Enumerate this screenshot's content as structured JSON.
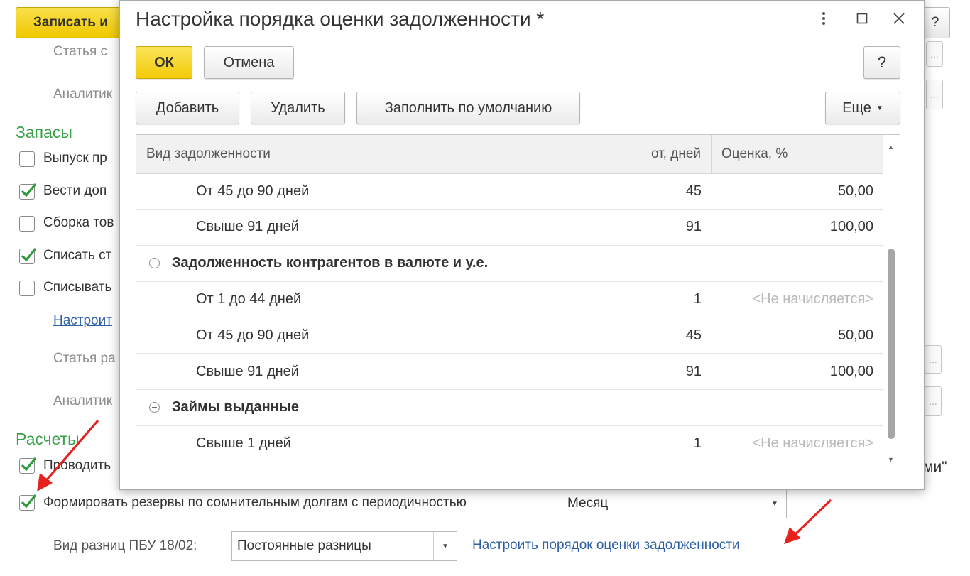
{
  "background": {
    "top_button_label": "Записать и",
    "help_label": "?",
    "rows_gray": [
      "Статья с",
      "Аналитик"
    ],
    "section_stock": "Запасы",
    "stock_options": [
      {
        "label": "Выпуск пр",
        "checked": false
      },
      {
        "label": "Вести доп",
        "checked": true
      },
      {
        "label": "Сборка тов",
        "checked": false
      },
      {
        "label": "Списать ст",
        "checked": true
      },
      {
        "label": "Списывать",
        "checked": false
      }
    ],
    "settings_link": "Настроит",
    "rows_gray_2": [
      "Статья ра",
      "Аналитик"
    ],
    "section_settlements": "Расчеты",
    "conduct_label": "Проводить",
    "conduct_checked": true,
    "right_suffix": "ми\"",
    "reserves_label": "Формировать резервы по сомнительным долгам с периодичностью",
    "reserves_checked": true,
    "period_value": "Месяц",
    "pbu_label": "Вид разниц ПБУ 18/02:",
    "pbu_value": "Постоянные разницы",
    "debt_link": "Настроить порядок оценки задолженности",
    "stub_glyph": "...",
    "annotation_color": "#e8211d"
  },
  "dialog": {
    "title": "Настройка порядка оценки задолженности *",
    "ok_label": "ОК",
    "cancel_label": "Отмена",
    "help_label": "?",
    "add_label": "Добавить",
    "delete_label": "Удалить",
    "fill_default_label": "Заполнить по умолчанию",
    "more_label": "Еще",
    "grid": {
      "columns": [
        "Вид задолженности",
        "от, дней",
        "Оценка, %"
      ],
      "rows": [
        {
          "type": "item",
          "name": "От 45 до 90 дней",
          "days": "45",
          "value": "50,00",
          "muted": false
        },
        {
          "type": "item",
          "name": "Свыше 91 дней",
          "days": "91",
          "value": "100,00",
          "muted": false
        },
        {
          "type": "group",
          "name": "Задолженность контрагентов в валюте и у.е."
        },
        {
          "type": "item",
          "name": "От 1 до 44 дней",
          "days": "1",
          "value": "<Не начисляется>",
          "muted": true
        },
        {
          "type": "item",
          "name": "От 45 до 90 дней",
          "days": "45",
          "value": "50,00",
          "muted": false
        },
        {
          "type": "item",
          "name": "Свыше 91 дней",
          "days": "91",
          "value": "100,00",
          "muted": false
        },
        {
          "type": "group",
          "name": "Займы выданные"
        },
        {
          "type": "item",
          "name": "Свыше 1 дней",
          "days": "1",
          "value": "<Не начисляется>",
          "muted": true
        }
      ]
    }
  }
}
